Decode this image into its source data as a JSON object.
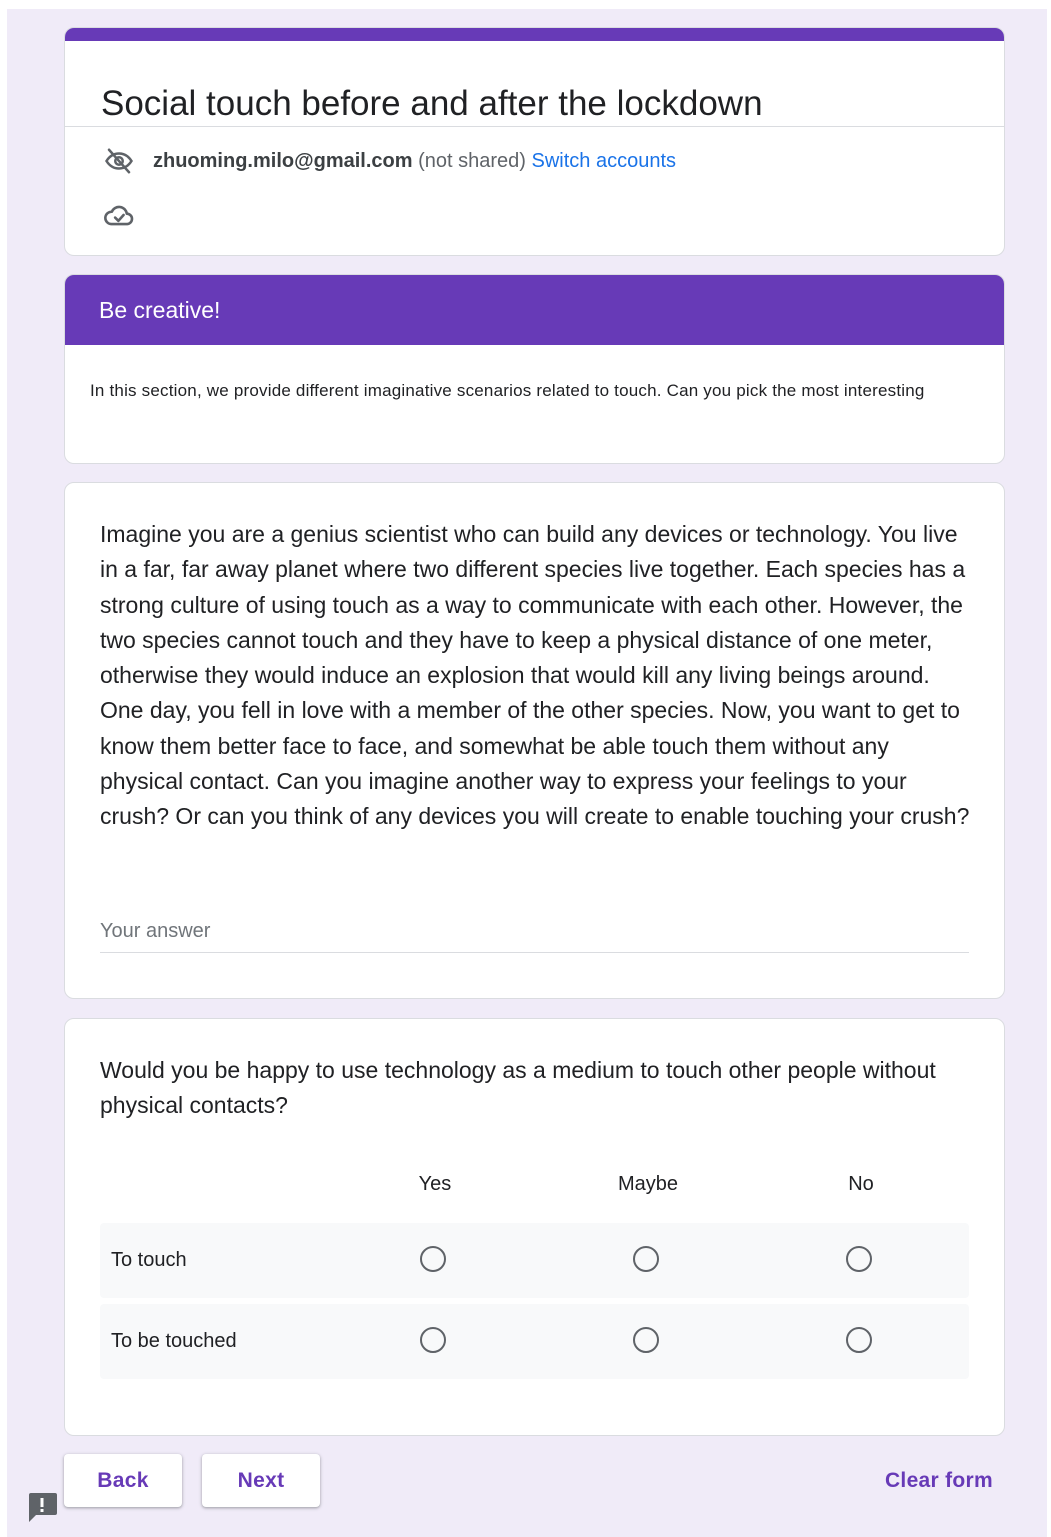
{
  "form": {
    "title": "Social touch before and after the lockdown",
    "accent_color": "#673ab7"
  },
  "account": {
    "email": "zhuoming.milo@gmail.com",
    "status": "(not shared)",
    "switch_label": "Switch accounts",
    "privacy_icon": "eye-off-icon",
    "saved_icon": "cloud-check-icon"
  },
  "section": {
    "title": "Be creative!",
    "description": "In this section, we provide different imaginative scenarios related to touch. Can you pick the most interesting"
  },
  "question1": {
    "text": "Imagine you are a genius scientist who can build any devices or technology. You live in a far, far away planet where two different species live together. Each species has a strong culture of using touch as a way to communicate with each other. However, the two species cannot touch and they have to keep a physical distance of one meter, otherwise they would induce an explosion that would kill any living beings around. One day, you fell in love with a member of the other species. Now, you want to get to know them better face to face, and somewhat be able touch them without any physical contact. Can you imagine another way to express your feelings to your crush? Or can you think of any devices you will create to enable touching your crush?",
    "placeholder": "Your answer",
    "value": ""
  },
  "question2": {
    "text": "Would you be happy to use technology as a medium to touch other people without physical contacts?",
    "columns": [
      "Yes",
      "Maybe",
      "No"
    ],
    "rows": [
      "To touch",
      "To be touched"
    ]
  },
  "footer": {
    "back_label": "Back",
    "next_label": "Next",
    "clear_label": "Clear form",
    "report_icon": "report-issue-icon"
  }
}
